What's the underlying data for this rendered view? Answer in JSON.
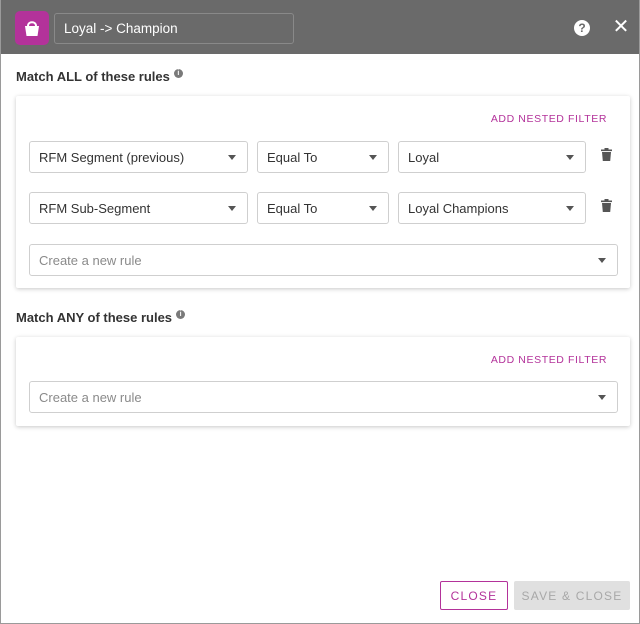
{
  "header": {
    "title_value": "Loyal -> Champion",
    "app_icon": "basket-icon",
    "help_glyph": "?",
    "close_glyph": "✕"
  },
  "match_all": {
    "title": "Match ALL of these rules",
    "add_nested_filter": "ADD NESTED FILTER",
    "rules": [
      {
        "field": "RFM Segment (previous)",
        "operator": "Equal To",
        "value": "Loyal"
      },
      {
        "field": "RFM Sub-Segment",
        "operator": "Equal To",
        "value": "Loyal Champions"
      }
    ],
    "new_rule_placeholder": "Create a new rule"
  },
  "match_any": {
    "title": "Match ANY of these rules",
    "add_nested_filter": "ADD NESTED FILTER",
    "new_rule_placeholder": "Create a new rule"
  },
  "footer": {
    "close_label": "CLOSE",
    "save_close_label": "SAVE & CLOSE"
  },
  "colors": {
    "brand": "#b3329a",
    "header_bg": "#6a6a6a",
    "disabled_bg": "#e0e0e0"
  }
}
